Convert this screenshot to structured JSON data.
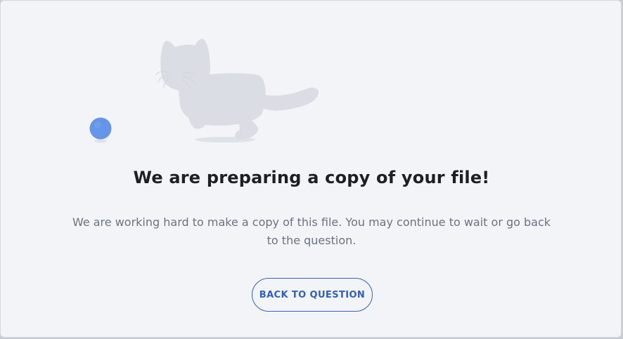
{
  "dialog": {
    "title": "We are preparing a copy of your file!",
    "message": "We are working hard to make a copy of this file. You may continue to wait or go back to the question.",
    "back_button_label": "BACK TO QUESTION"
  },
  "illustration": {
    "subject": "cat-chasing-ball",
    "icons": [
      "cat-icon",
      "ball-icon"
    ]
  },
  "colors": {
    "accent": "#2f5fc4",
    "ball": "#6495e8",
    "cat": "#dadde3",
    "background": "#f3f4f8",
    "title": "#1e1f24",
    "message": "#6c7280"
  }
}
